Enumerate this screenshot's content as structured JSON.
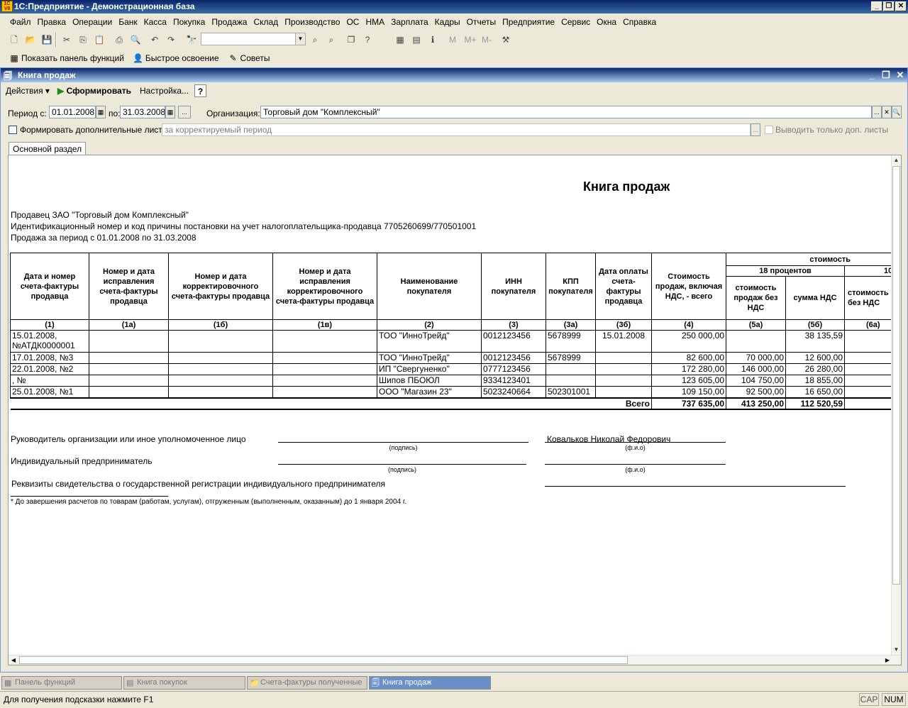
{
  "app": {
    "title": "1С:Предприятие - Демонстрационная база",
    "logo_text": "1С"
  },
  "menu": [
    "Файл",
    "Правка",
    "Операции",
    "Банк",
    "Касса",
    "Покупка",
    "Продажа",
    "Склад",
    "Производство",
    "ОС",
    "НМА",
    "Зарплата",
    "Кадры",
    "Отчеты",
    "Предприятие",
    "Сервис",
    "Окна",
    "Справка"
  ],
  "quickbar": {
    "functions": "Показать панель функций",
    "learn": "Быстрое освоение",
    "tips": "Советы"
  },
  "doc": {
    "title": "Книга продаж",
    "actions": "Действия",
    "generate": "Сформировать",
    "settings": "Настройка...",
    "help": "?",
    "period_from_label": "Период с:",
    "period_from": "01.01.2008",
    "period_to_label": "по:",
    "period_to": "31.03.2008",
    "ellipsis": "...",
    "org_label": "Организация:",
    "org": "Торговый дом \"Комплексный\"",
    "extra_sheets_label": "Формировать дополнительные листы",
    "correction_placeholder": "за корректируемый период",
    "only_extra_label": "Выводить только доп. листы",
    "tab": "Основной раздел"
  },
  "report": {
    "heading": "Книга продаж",
    "seller": "Продавец  ЗАО \"Торговый дом Комплексный\"",
    "inn_line": "Идентификационный номер и код причины постановки на учет налогоплательщика-продавца  7705260699/770501001",
    "period_line": "Продажа за период с 01.01.2008 по 31.03.2008",
    "headers": {
      "c1": "Дата и номер счета-фактуры продавца",
      "c1a": "Номер и дата исправления счета-фактуры продавца",
      "c1b": "Номер и дата корректировочного счета-фактуры продавца",
      "c1c": "Номер и дата исправления корректировочного счета-фактуры продавца",
      "c2": "Наименование покупателя",
      "c3": "ИНН покупателя",
      "c3a": "КПП покупателя",
      "c3b": "Дата оплаты счета-фактуры продавца",
      "c4": "Стоимость продаж, включая НДС, - всего",
      "group": "стоимость",
      "p18": "18 процентов",
      "p10": "10",
      "c5a": "стоимость продаж без НДС",
      "c5b": "сумма НДС",
      "c6a": "стоимость продаж без НДС"
    },
    "col_nums": [
      "(1)",
      "(1а)",
      "(1б)",
      "(1в)",
      "(2)",
      "(3)",
      "(3а)",
      "(3б)",
      "(4)",
      "(5а)",
      "(5б)",
      "(6а)"
    ],
    "rows": [
      {
        "c1": "15.01.2008,",
        "c1_2": "№АТДК0000001",
        "c2": "ТОО \"ИнноТрейд\"",
        "c3": "0012123456",
        "c3a": "5678999",
        "c3b": "15.01.2008",
        "c4": "250 000,00",
        "c5a": "",
        "c5b": "38 135,59"
      },
      {
        "c1": "17.01.2008, №3",
        "c2": "ТОО \"ИнноТрейд\"",
        "c3": "0012123456",
        "c3a": "5678999",
        "c3b": "",
        "c4": "82 600,00",
        "c5a": "70 000,00",
        "c5b": "12 600,00"
      },
      {
        "c1": "22.01.2008, №2",
        "c2": "ИП \"Свергуненко\"",
        "c3": "0777123456",
        "c3a": "",
        "c3b": "",
        "c4": "172 280,00",
        "c5a": "146 000,00",
        "c5b": "26 280,00"
      },
      {
        "c1": ", №",
        "c2": "Шипов ПБОЮЛ",
        "c3": "9334123401",
        "c3a": "",
        "c3b": "",
        "c4": "123 605,00",
        "c5a": "104 750,00",
        "c5b": "18 855,00"
      },
      {
        "c1": "25.01.2008, №1",
        "c2": "ООО \"Магазин 23\"",
        "c3": "5023240664",
        "c3a": "502301001",
        "c3b": "",
        "c4": "109 150,00",
        "c5a": "92 500,00",
        "c5b": "16 650,00"
      }
    ],
    "total_label": "Всего",
    "total_c4": "737 635,00",
    "total_c5a": "413 250,00",
    "total_c5b": "112 520,59",
    "sign_head": "Руководитель организации или иное уполномоченное лицо",
    "head_name": "Ковальков Николай Федорович",
    "sign_ip": "Индивидуальный предприниматель",
    "podpis": "(подпись)",
    "fio": "(ф.и.о)",
    "req": "Реквизиты свидетельства о государственной регистрации индивидуального предпринимателя",
    "footnote": "* До завершения расчетов по товарам (работам, услугам), отгруженным (выполненным, оказанным) до 1 января 2004 г."
  },
  "taskbar": [
    "Панель функций",
    "Книга покупок",
    "Счета-фактуры полученные",
    "Книга продаж"
  ],
  "status": {
    "hint": "Для получения подсказки нажмите F1",
    "cap": "CAP",
    "num": "NUM"
  }
}
